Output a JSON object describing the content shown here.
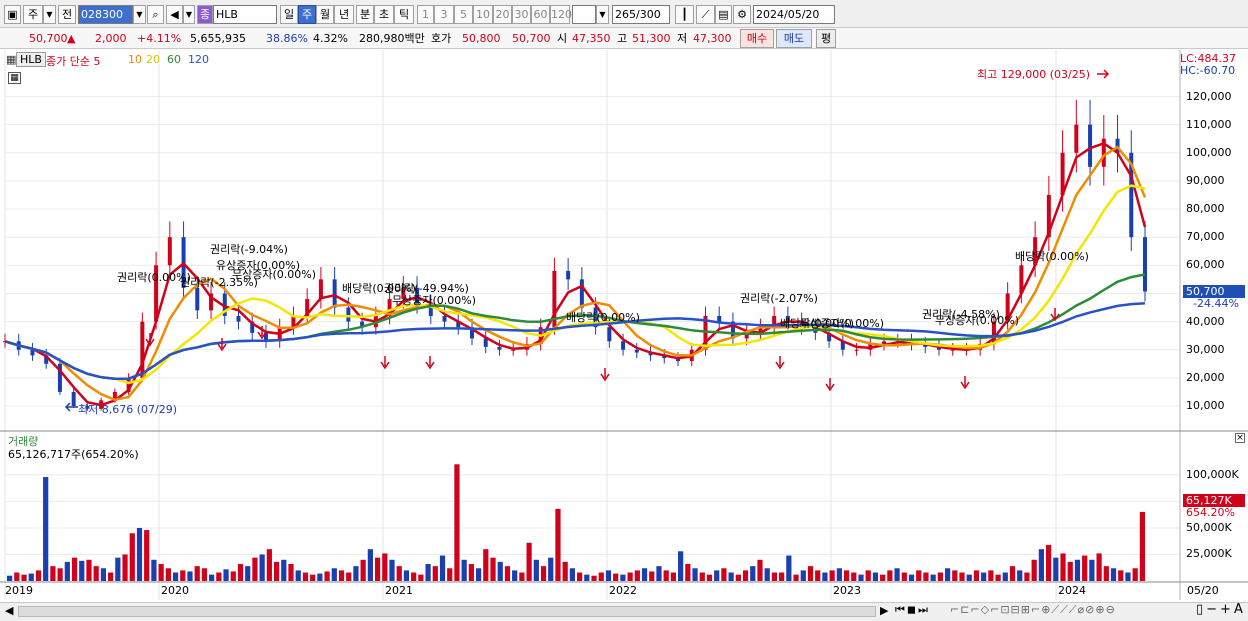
{
  "toolbar": {
    "period_type": "주",
    "prev_label": "전",
    "code": "028300",
    "name_badge": "종",
    "name": "HLB",
    "periods": [
      "일",
      "주",
      "월",
      "년",
      "분",
      "초",
      "틱"
    ],
    "selected_period": "주",
    "minutes": [
      "1",
      "3",
      "5",
      "10",
      "20",
      "30",
      "60",
      "120"
    ],
    "count": "265",
    "count_total": "/300",
    "date": "2024/05/20"
  },
  "quote": {
    "price": "50,700",
    "change_arrow": "▲",
    "change": "2,000",
    "change_pct": "+4.11%",
    "volume": "5,655,935",
    "ratio1": "38.86%",
    "ratio2": "4.32%",
    "amount": "280,980백만",
    "bid_label": "호가",
    "bid_ask": "50,800",
    "bid_bid": "50,700",
    "open_label": "시",
    "open": "47,350",
    "high_label": "고",
    "high": "51,300",
    "low_label": "저",
    "low": "47,300",
    "buy_label": "매수",
    "sell_label": "매도",
    "flat_label": "평"
  },
  "price_panel": {
    "code_tag": "HLB",
    "legend_title": "종가 단순 5",
    "ma_periods": [
      "10",
      "20",
      "60",
      "120"
    ],
    "lc": "LC:484.37",
    "hc": "HC:-60.70",
    "max_note": "최고 129,000 (03/25)",
    "min_note": "최저 8,676 (07/29)",
    "current_price_tag": "50,700",
    "current_pct_tag": "-24.44%",
    "y_ticks": [
      "120,000",
      "110,000",
      "100,000",
      "90,000",
      "80,000",
      "70,000",
      "60,000",
      "50,000",
      "40,000",
      "30,000",
      "20,000",
      "10,000"
    ],
    "events": [
      "권리락(0.00%)",
      "권리락(-2.35%)",
      "권리락(-9.04%)",
      "유상증자(0.00%)",
      "무상증자(0.00%)",
      "배당락(0.00%)",
      "권리락(-49.94%)",
      "무상증자(0.00%)",
      "배당락(0.00%)",
      "권리락(-2.07%)",
      "배당락(0.00%)",
      "무상증자(0.00%)",
      "권리락(-4.58%)",
      "무상증자(0.00%)",
      "배당락(0.00%)"
    ]
  },
  "volume_panel": {
    "title": "거래량",
    "value_label": "65,126,717주(654.20%)",
    "y_ticks": [
      "100,000K",
      "75,000K",
      "50,000K",
      "25,000K"
    ],
    "current_tag": "65,127K",
    "pct_tag": "654.20%"
  },
  "x_axis": {
    "labels": [
      "2019",
      "2020",
      "2021",
      "2022",
      "2023",
      "2024"
    ],
    "end_label": "05/20"
  },
  "colors": {
    "up": "#d0021b",
    "down": "#1a3fb0",
    "ma5": "#d0021b",
    "ma10": "#f08c00",
    "ma20": "#f5e600",
    "ma60": "#2e8b3a",
    "ma120": "#2a52c8"
  },
  "chart_data": [
    {
      "type": "line",
      "title": "",
      "ylim": [
        0,
        130000
      ],
      "x_ticks": [
        "2019",
        "2020",
        "2021",
        "2022",
        "2023",
        "2024"
      ],
      "series": [
        {
          "name": "종가",
          "note": "weekly closes (approx)",
          "values": [
            33000,
            30000,
            28000,
            25000,
            15000,
            10000,
            9000,
            12000,
            15000,
            20000,
            40000,
            60000,
            70000,
            52000,
            44000,
            50000,
            42000,
            40000,
            36000,
            33000,
            38000,
            42000,
            48000,
            55000,
            45000,
            40000,
            38000,
            42000,
            48000,
            52000,
            46000,
            42000,
            40000,
            38000,
            34000,
            31000,
            30000,
            30000,
            32000,
            38000,
            58000,
            55000,
            45000,
            38000,
            33000,
            30000,
            29000,
            28000,
            27000,
            26000,
            30000,
            42000,
            40000,
            34000,
            36000,
            38000,
            42000,
            40000,
            38000,
            36000,
            33000,
            30000,
            30000,
            32000,
            33000,
            33000,
            32000,
            31000,
            30000,
            30000,
            30000,
            32000,
            40000,
            50000,
            60000,
            70000,
            85000,
            100000,
            110000,
            95000,
            105000,
            100000,
            70000,
            50700
          ]
        },
        {
          "name": "5",
          "values": []
        },
        {
          "name": "10",
          "values": []
        },
        {
          "name": "20",
          "values": []
        },
        {
          "name": "60",
          "values": []
        },
        {
          "name": "120",
          "values": []
        }
      ],
      "max": {
        "value": 129000,
        "date": "03/25"
      },
      "min": {
        "value": 8676,
        "date": "07/29"
      }
    },
    {
      "type": "bar",
      "title": "거래량",
      "ylim": [
        0,
        115000
      ],
      "x_ticks": [
        "2019",
        "2020",
        "2021",
        "2022",
        "2023",
        "2024"
      ],
      "series": [
        {
          "name": "거래량",
          "unit": "K",
          "values": [
            5000,
            8000,
            6000,
            7000,
            10000,
            98000,
            14000,
            12000,
            18000,
            22000,
            19000,
            20000,
            14000,
            12000,
            8000,
            22000,
            25000,
            45000,
            50000,
            48000,
            20000,
            16000,
            12000,
            8000,
            10000,
            9000,
            14000,
            12000,
            6000,
            8000,
            11000,
            9000,
            16000,
            14000,
            22000,
            25000,
            30000,
            18000,
            20000,
            16000,
            10000,
            8000,
            6000,
            7000,
            9000,
            12000,
            10000,
            8000,
            14000,
            20000,
            30000,
            22000,
            26000,
            20000,
            14000,
            10000,
            8000,
            6000,
            16000,
            14000,
            24000,
            12000,
            110000,
            20000,
            16000,
            12000,
            30000,
            22000,
            18000,
            14000,
            10000,
            8000,
            36000,
            20000,
            14000,
            22000,
            68000,
            18000,
            12000,
            8000,
            6000,
            5000,
            8000,
            10000,
            7000,
            6000,
            8000,
            10000,
            12000,
            9000,
            14000,
            10000,
            8000,
            28000,
            16000,
            12000,
            8000,
            6000,
            10000,
            12000,
            8000,
            6000,
            10000,
            14000,
            20000,
            12000,
            8000,
            8000,
            24000,
            6000,
            10000,
            14000,
            10000,
            8000,
            10000,
            12000,
            10000,
            8000,
            6000,
            10000,
            8000,
            6000,
            10000,
            12000,
            8000,
            6000,
            10000,
            8000,
            6000,
            8000,
            12000,
            10000,
            8000,
            6000,
            10000,
            8000,
            10000,
            6000,
            8000,
            14000,
            10000,
            8000,
            20000,
            30000,
            34000,
            22000,
            26000,
            18000,
            20000,
            24000,
            20000,
            26000,
            14000,
            12000,
            10000,
            8000,
            12000,
            65127
          ]
        }
      ]
    }
  ]
}
